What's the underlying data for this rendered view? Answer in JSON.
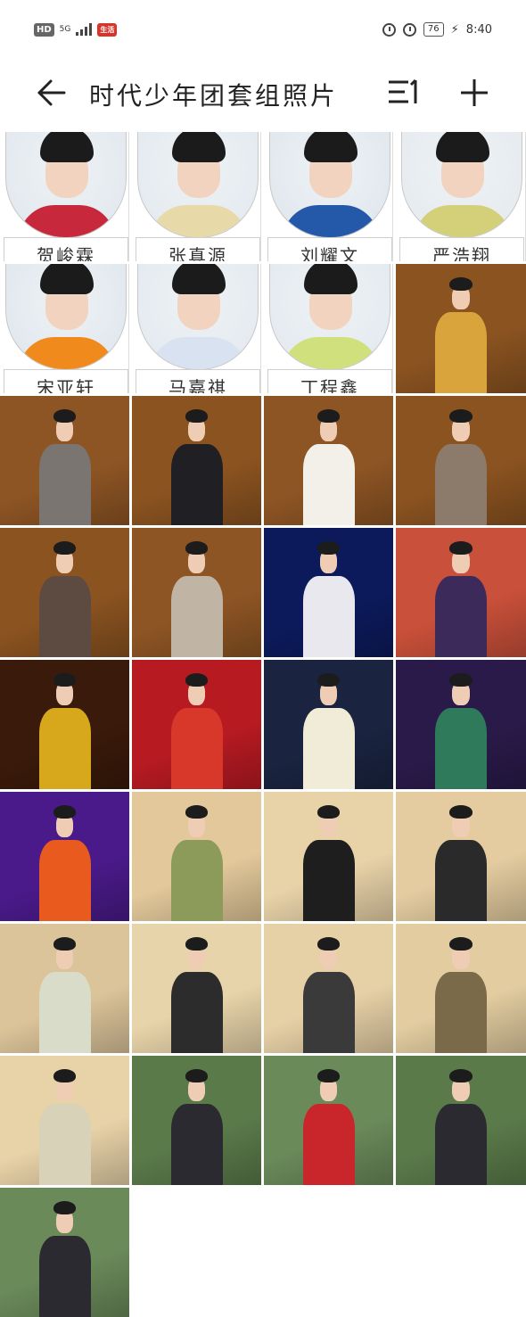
{
  "status_bar": {
    "hd_label": "HD",
    "network_label": "5G",
    "promo_label": "生活",
    "battery_level": "76",
    "time": "8:40"
  },
  "header": {
    "title": "时代少年团套组照片",
    "back_icon": "arrow-left-icon",
    "sort_icon": "sort-icon",
    "add_icon": "plus-icon"
  },
  "portraits": [
    {
      "name": "贺峻霖",
      "bg": "#dfe6ec",
      "shirt": "#c8283b"
    },
    {
      "name": "张真源",
      "bg": "#e1e8ee",
      "shirt": "#e8d9a8"
    },
    {
      "name": "刘耀文",
      "bg": "#dde5ec",
      "shirt": "#2458a8"
    },
    {
      "name": "严浩翔",
      "bg": "#e4e9ee",
      "shirt": "#d4d07a"
    },
    {
      "name": "宋亚轩",
      "bg": "#dde5ec",
      "shirt": "#f08a1c"
    },
    {
      "name": "马嘉祺",
      "bg": "#e1e8ee",
      "shirt": "#d9e2f0"
    },
    {
      "name": "丁程鑫",
      "bg": "#e1e8ee",
      "shirt": "#cfe07c"
    }
  ],
  "photos": [
    {
      "bg": "#8b5320",
      "body": "#d9a43c"
    },
    {
      "bg": "#8e5524",
      "body": "#7a7570"
    },
    {
      "bg": "#8b5320",
      "body": "#1f1f24"
    },
    {
      "bg": "#8e5524",
      "body": "#f2f0e8"
    },
    {
      "bg": "#8b5320",
      "body": "#8c7a6a"
    },
    {
      "bg": "#8b5320",
      "body": "#5d4a40"
    },
    {
      "bg": "#8e5524",
      "body": "#c0b4a4"
    },
    {
      "bg": "#0c1a5c",
      "body": "#e8e8ee"
    },
    {
      "bg": "#c9503a",
      "body": "#3c2a5a"
    },
    {
      "bg": "#3a1a0a",
      "body": "#d8a81c"
    },
    {
      "bg": "#b81a22",
      "body": "#d8382a"
    },
    {
      "bg": "#1a2440",
      "body": "#f0ecd8"
    },
    {
      "bg": "#2a1a4a",
      "body": "#2e7a5a"
    },
    {
      "bg": "#4a1a8a",
      "body": "#e85a1e"
    },
    {
      "bg": "#e2c89a",
      "body": "#8c9a5a"
    },
    {
      "bg": "#e8d2a8",
      "body": "#1e1e1e"
    },
    {
      "bg": "#e4cca0",
      "body": "#2a2a2a"
    },
    {
      "bg": "#dcc49a",
      "body": "#d8dcc8"
    },
    {
      "bg": "#e8d4aa",
      "body": "#2c2c2c"
    },
    {
      "bg": "#e6d0a6",
      "body": "#3a3a3a"
    },
    {
      "bg": "#e2cca0",
      "body": "#7a6a4a"
    },
    {
      "bg": "#e8d2a8",
      "body": "#d8d2b8"
    },
    {
      "bg": "#5a7a4a",
      "body": "#2a2a30"
    },
    {
      "bg": "#6a8a5a",
      "body": "#c8262a"
    },
    {
      "bg": "#5a7a4a",
      "body": "#2a2a30"
    },
    {
      "bg": "#6a8a5a",
      "body": "#2a2a30"
    }
  ]
}
